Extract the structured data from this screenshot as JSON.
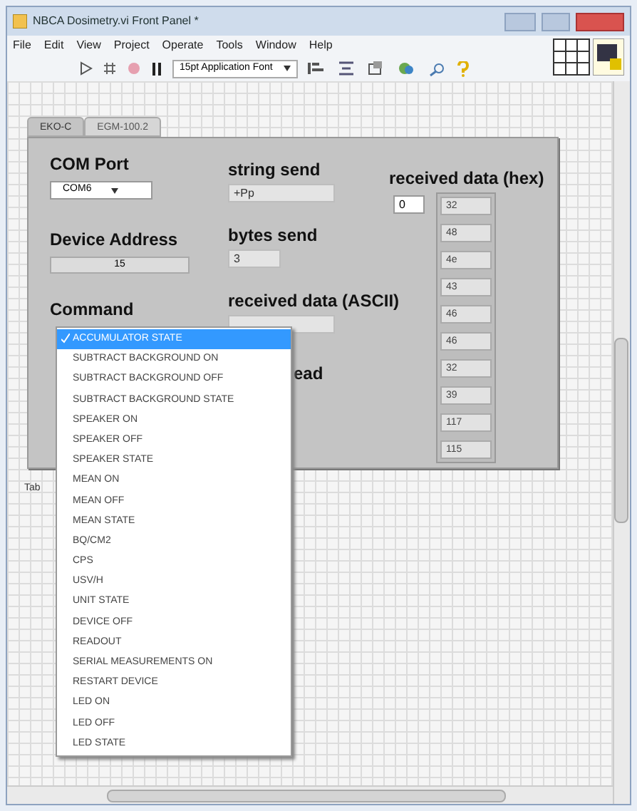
{
  "window": {
    "title": "NBCA Dosimetry.vi Front Panel *"
  },
  "menu": [
    "File",
    "Edit",
    "View",
    "Project",
    "Operate",
    "Tools",
    "Window",
    "Help"
  ],
  "toolbar": {
    "font": "15pt Application Font"
  },
  "tabs": [
    {
      "label": "EKO-C",
      "selected": true
    },
    {
      "label": "EGM-100.2",
      "selected": false
    }
  ],
  "panel": {
    "com_port": {
      "label": "COM Port",
      "value": "COM6"
    },
    "device_address": {
      "label": "Device Address",
      "value": "15"
    },
    "command": {
      "label": "Command"
    },
    "string_send": {
      "label": "string send",
      "value": "+Pp"
    },
    "bytes_send": {
      "label": "bytes send",
      "value": "3"
    },
    "received_ascii": {
      "label": "received data (ASCII)"
    },
    "bytes_read": {
      "label": "ead"
    },
    "received_hex": {
      "label": "received data (hex)",
      "index": "0",
      "values": [
        "32",
        "48",
        "4e",
        "43",
        "46",
        "46",
        "32",
        "39",
        "117",
        "115"
      ]
    }
  },
  "tab_label": "Tab",
  "dropdown": [
    {
      "label": "ACCUMULATOR STATE",
      "selected": true
    },
    {
      "label": "SUBTRACT BACKGROUND ON",
      "selected": false
    },
    {
      "label": "SUBTRACT BACKGROUND OFF",
      "selected": false
    },
    {
      "label": "SUBTRACT BACKGROUND STATE",
      "selected": false
    },
    {
      "label": "SPEAKER ON",
      "selected": false
    },
    {
      "label": "SPEAKER OFF",
      "selected": false
    },
    {
      "label": "SPEAKER STATE",
      "selected": false
    },
    {
      "label": "MEAN ON",
      "selected": false
    },
    {
      "label": "MEAN OFF",
      "selected": false
    },
    {
      "label": "MEAN STATE",
      "selected": false
    },
    {
      "label": "BQ/CM2",
      "selected": false
    },
    {
      "label": "CPS",
      "selected": false
    },
    {
      "label": "USV/H",
      "selected": false
    },
    {
      "label": "UNIT STATE",
      "selected": false
    },
    {
      "label": "DEVICE OFF",
      "selected": false
    },
    {
      "label": "READOUT",
      "selected": false
    },
    {
      "label": "SERIAL MEASUREMENTS ON",
      "selected": false
    },
    {
      "label": "RESTART DEVICE",
      "selected": false
    },
    {
      "label": "LED ON",
      "selected": false
    },
    {
      "label": "LED OFF",
      "selected": false
    },
    {
      "label": "LED STATE",
      "selected": false
    }
  ]
}
